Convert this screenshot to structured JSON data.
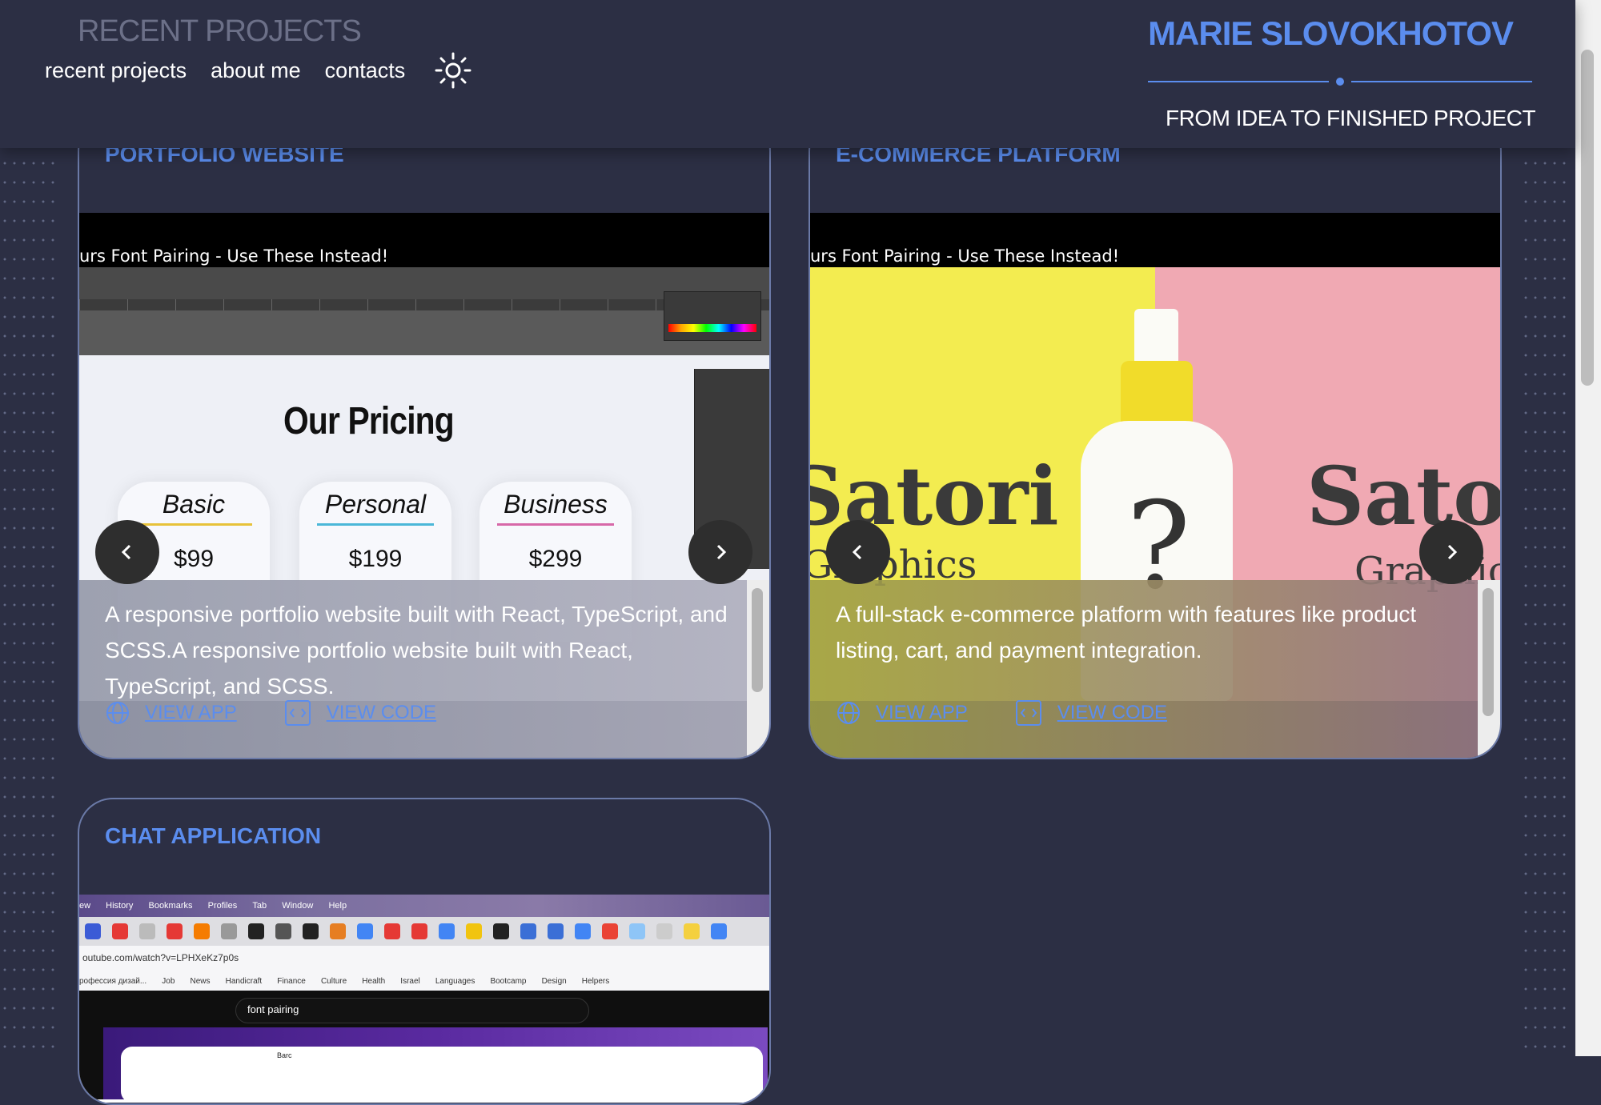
{
  "header": {
    "section_title": "RECENT PROJECTS",
    "nav": [
      "recent projects",
      "about me",
      "contacts"
    ],
    "theme_toggle_icon": "sun-icon",
    "brand": "MARIE SLOVOKHOTOV",
    "tagline": "FROM IDEA TO FINISHED PROJECT"
  },
  "colors": {
    "background": "#2c2f44",
    "accent": "#5b8dee",
    "card_border": "#6b7aa8"
  },
  "projects": [
    {
      "title": "PORTFOLIO WEBSITE",
      "video_caption": "urs Font Pairing - Use These Instead!",
      "description": "A responsive portfolio website built with React, TypeScript, and SCSS.A responsive portfolio website built with React, TypeScript, and SCSS.",
      "view_app": "VIEW APP",
      "view_code": "VIEW CODE",
      "preview": {
        "heading": "Our Pricing",
        "plans": [
          {
            "name": "Basic",
            "price": "$99",
            "color": "#e7c23a"
          },
          {
            "name": "Personal",
            "price": "$199",
            "color": "#4bb7d8"
          },
          {
            "name": "Business",
            "price": "$299",
            "color": "#d768a8"
          }
        ]
      }
    },
    {
      "title": "E-COMMERCE PLATFORM",
      "video_caption": "urs Font Pairing - Use These Instead!",
      "description": "A full-stack e-commerce platform with features like product listing, cart, and payment integration.",
      "view_app": "VIEW APP",
      "view_code": "VIEW CODE",
      "preview": {
        "left_word": "Satori",
        "left_sub": "Graphics",
        "right_word": "Sato",
        "right_sub": "Graphics",
        "bottle_mark": "?"
      }
    },
    {
      "title": "CHAT APPLICATION",
      "preview": {
        "menu": [
          "ew",
          "History",
          "Bookmarks",
          "Profiles",
          "Tab",
          "Window",
          "Help"
        ],
        "url": "outube.com/watch?v=LPHXeKz7p0s",
        "bookmarks": [
          "рофессия дизай...",
          "Job",
          "News",
          "Handicraft",
          "Finance",
          "Culture",
          "Health",
          "Israel",
          "Languages",
          "Bootcamp",
          "Design",
          "Helpers"
        ],
        "search": "font pairing",
        "page_logo": "Barc"
      }
    }
  ]
}
